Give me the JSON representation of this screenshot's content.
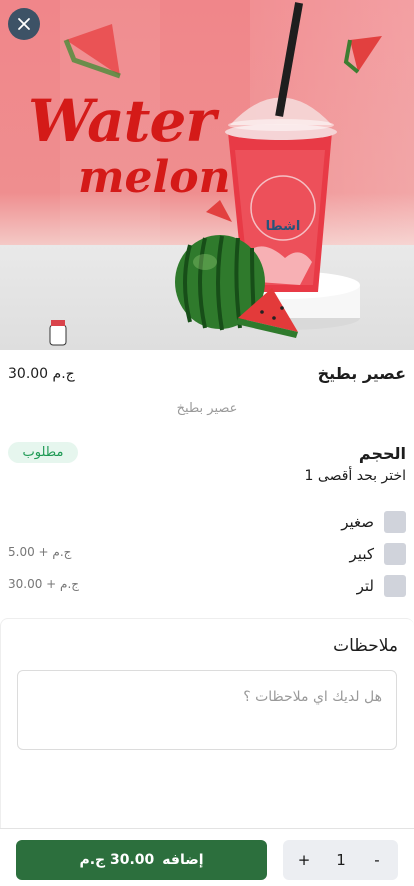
{
  "hero": {
    "title_line1": "Water",
    "title_line2": "melon",
    "cup_logo": "اشطا"
  },
  "product": {
    "name": "عصير بطيخ",
    "price": "30.00 ج.م",
    "description": "عصير بطيخ"
  },
  "size_group": {
    "title": "الحجم",
    "subtitle": "اختر بحد أقصى 1",
    "required_label": "مطلوب",
    "options": [
      {
        "label": "صغير",
        "extra": ""
      },
      {
        "label": "كبير",
        "extra": "5.00 + ج.م"
      },
      {
        "label": "لتر",
        "extra": "30.00 + ج.م"
      }
    ]
  },
  "notes": {
    "title": "ملاحظات",
    "placeholder": "هل لديك اي ملاحظات ؟"
  },
  "cart": {
    "add_label": "إضافه",
    "add_price": "30.00 ج.م",
    "quantity": "1",
    "plus": "+",
    "minus": "-"
  },
  "colors": {
    "primary": "#2c6f3d",
    "badge_bg": "#e6f6ee",
    "badge_text": "#1f9a55",
    "hero_red": "#d41a18",
    "close_bg": "#3d5266"
  },
  "icons": {
    "close": "close-icon"
  }
}
